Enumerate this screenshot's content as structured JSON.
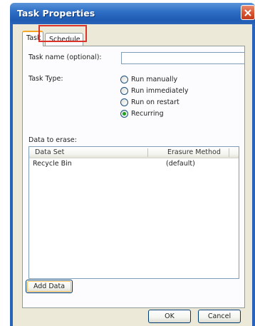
{
  "window": {
    "title": "Task Properties"
  },
  "tabs": [
    {
      "label": "Task",
      "selected": true
    },
    {
      "label": "Schedule",
      "selected": false
    }
  ],
  "form": {
    "task_name_label": "Task name (optional):",
    "task_name_value": "",
    "task_type_label": "Task Type:",
    "task_types": [
      {
        "label": "Run manually",
        "checked": false
      },
      {
        "label": "Run immediately",
        "checked": false
      },
      {
        "label": "Run on restart",
        "checked": false
      },
      {
        "label": "Recurring",
        "checked": true
      }
    ],
    "data_to_erase_label": "Data to erase:"
  },
  "table": {
    "columns": [
      "Data Set",
      "Erasure Method"
    ],
    "rows": [
      {
        "data_set": "Recycle Bin",
        "method": "(default)"
      }
    ]
  },
  "buttons": {
    "add_data": "Add Data",
    "ok": "OK",
    "cancel": "Cancel"
  },
  "colors": {
    "titlebar": "#2f6fc6",
    "highlight": "#d9332a",
    "selected_radio": "#21a121"
  }
}
